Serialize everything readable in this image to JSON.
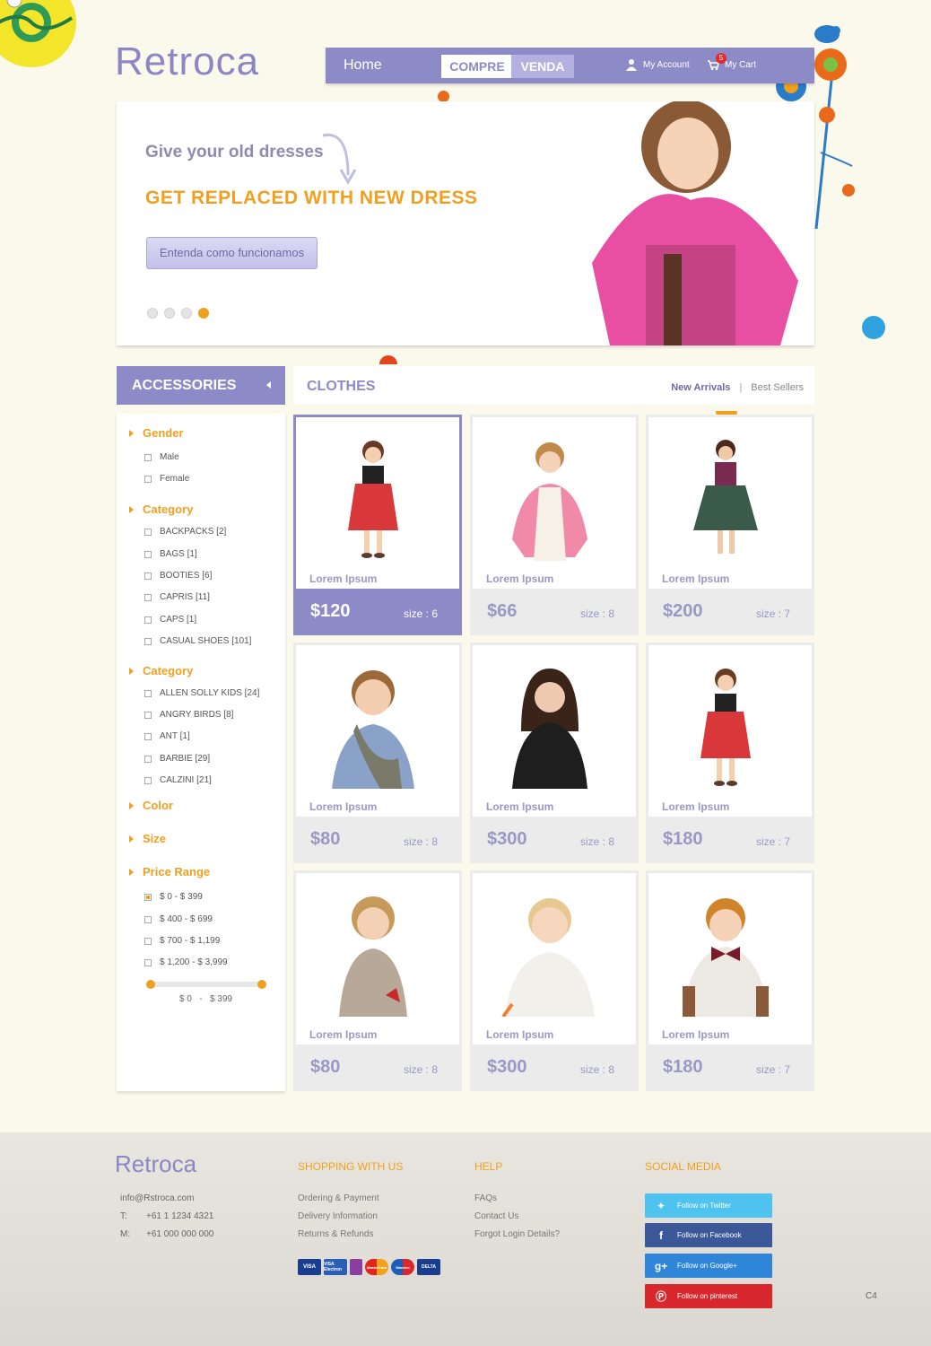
{
  "brand": {
    "logo_text": "Retroca"
  },
  "nav": {
    "home": "Home",
    "compre": "COMPRE",
    "venda": "VENDA",
    "account": "My Account",
    "cart": "My Cart",
    "cart_count": "5"
  },
  "hero": {
    "line1": "Give your old dresses",
    "line2": "GET REPLACED WITH NEW DRESS",
    "button": "Entenda como funcionamos",
    "slide_count": 4,
    "active_slide": 4
  },
  "sidebar": {
    "title": "ACCESSORIES",
    "sections": [
      {
        "heading": "Gender",
        "options": [
          "Male",
          "Female"
        ]
      },
      {
        "heading": "Category",
        "options": [
          "BACKPACKS [2]",
          "BAGS [1]",
          "BOOTIES [6]",
          "CAPRIS [11]",
          "CAPS [1]",
          "CASUAL SHOES [101]"
        ]
      },
      {
        "heading": "Category",
        "options": [
          "ALLEN SOLLY KIDS [24]",
          "ANGRY BIRDS [8]",
          "ANT [1]",
          "BARBIE [29]",
          "CALZINI [21]"
        ]
      },
      {
        "heading": "Color",
        "options": []
      },
      {
        "heading": "Size",
        "options": []
      },
      {
        "heading": "Price Range",
        "options": [
          "$ 0 - $ 399",
          "$ 400 - $ 699",
          "$ 700 - $ 1,199",
          "$ 1,200 - $ 3,999"
        ],
        "selected": 0
      }
    ],
    "range_min": "$ 0",
    "range_sep": "-",
    "range_max": "$ 399"
  },
  "clothes": {
    "title": "CLOTHES",
    "tab_active": "New Arrivals",
    "tab_sep": "|",
    "tab_other": "Best Sellers",
    "products": [
      {
        "name": "Lorem Ipsum",
        "price": "$120",
        "size": "size : 6",
        "selected": true,
        "photo": "girl-red-dress"
      },
      {
        "name": "Lorem Ipsum",
        "price": "$66",
        "size": "size : 8",
        "photo": "girl-pink-cardigan"
      },
      {
        "name": "Lorem Ipsum",
        "price": "$200",
        "size": "size : 7",
        "photo": "girl-green-skirt"
      },
      {
        "name": "Lorem Ipsum",
        "price": "$80",
        "size": "size : 8",
        "photo": "boy-scarf"
      },
      {
        "name": "Lorem Ipsum",
        "price": "$300",
        "size": "size : 8",
        "photo": "girl-black-coat"
      },
      {
        "name": "Lorem Ipsum",
        "price": "$180",
        "size": "size : 7",
        "photo": "girl-red-dress"
      },
      {
        "name": "Lorem Ipsum",
        "price": "$80",
        "size": "size : 8",
        "photo": "girl-grey-dress"
      },
      {
        "name": "Lorem Ipsum",
        "price": "$300",
        "size": "size : 8",
        "photo": "boy-tshirt"
      },
      {
        "name": "Lorem Ipsum",
        "price": "$180",
        "size": "size : 7",
        "photo": "boy-bowtie"
      }
    ]
  },
  "footer": {
    "logo_text": "Retroca",
    "email": "info@Rstroca.com",
    "t_label": "T:",
    "t_value": "+61 1 1234 4321",
    "m_label": "M:",
    "m_value": "+61 000 000 000",
    "shopping_title": "SHOPPING WITH US",
    "shopping_links": [
      "Ordering & Payment",
      "Delivery Information",
      "Returns & Refunds"
    ],
    "help_title": "HELP",
    "help_links": [
      "FAQs",
      "Contact Us",
      "Forgot Login Details?"
    ],
    "social_title": "SOCIAL MEDIA",
    "social": [
      {
        "label": "Follow on Twitter",
        "color": "#4fc3f0",
        "icon": "twitter-icon"
      },
      {
        "label": "Follow on Facebook",
        "color": "#3b5998",
        "icon": "facebook-icon"
      },
      {
        "label": "Follow on Google+",
        "color": "#2f86d8",
        "icon": "google-plus-icon"
      },
      {
        "label": "Follow on pinterest",
        "color": "#d9272e",
        "icon": "pinterest-icon"
      }
    ],
    "payment_cards": [
      "VISA",
      "VISA Electron",
      "",
      "MasterCard",
      "Maestro",
      "DELTA"
    ],
    "code": "C4"
  },
  "colors": {
    "accent": "#8d8bc7",
    "orange": "#f0a020"
  }
}
